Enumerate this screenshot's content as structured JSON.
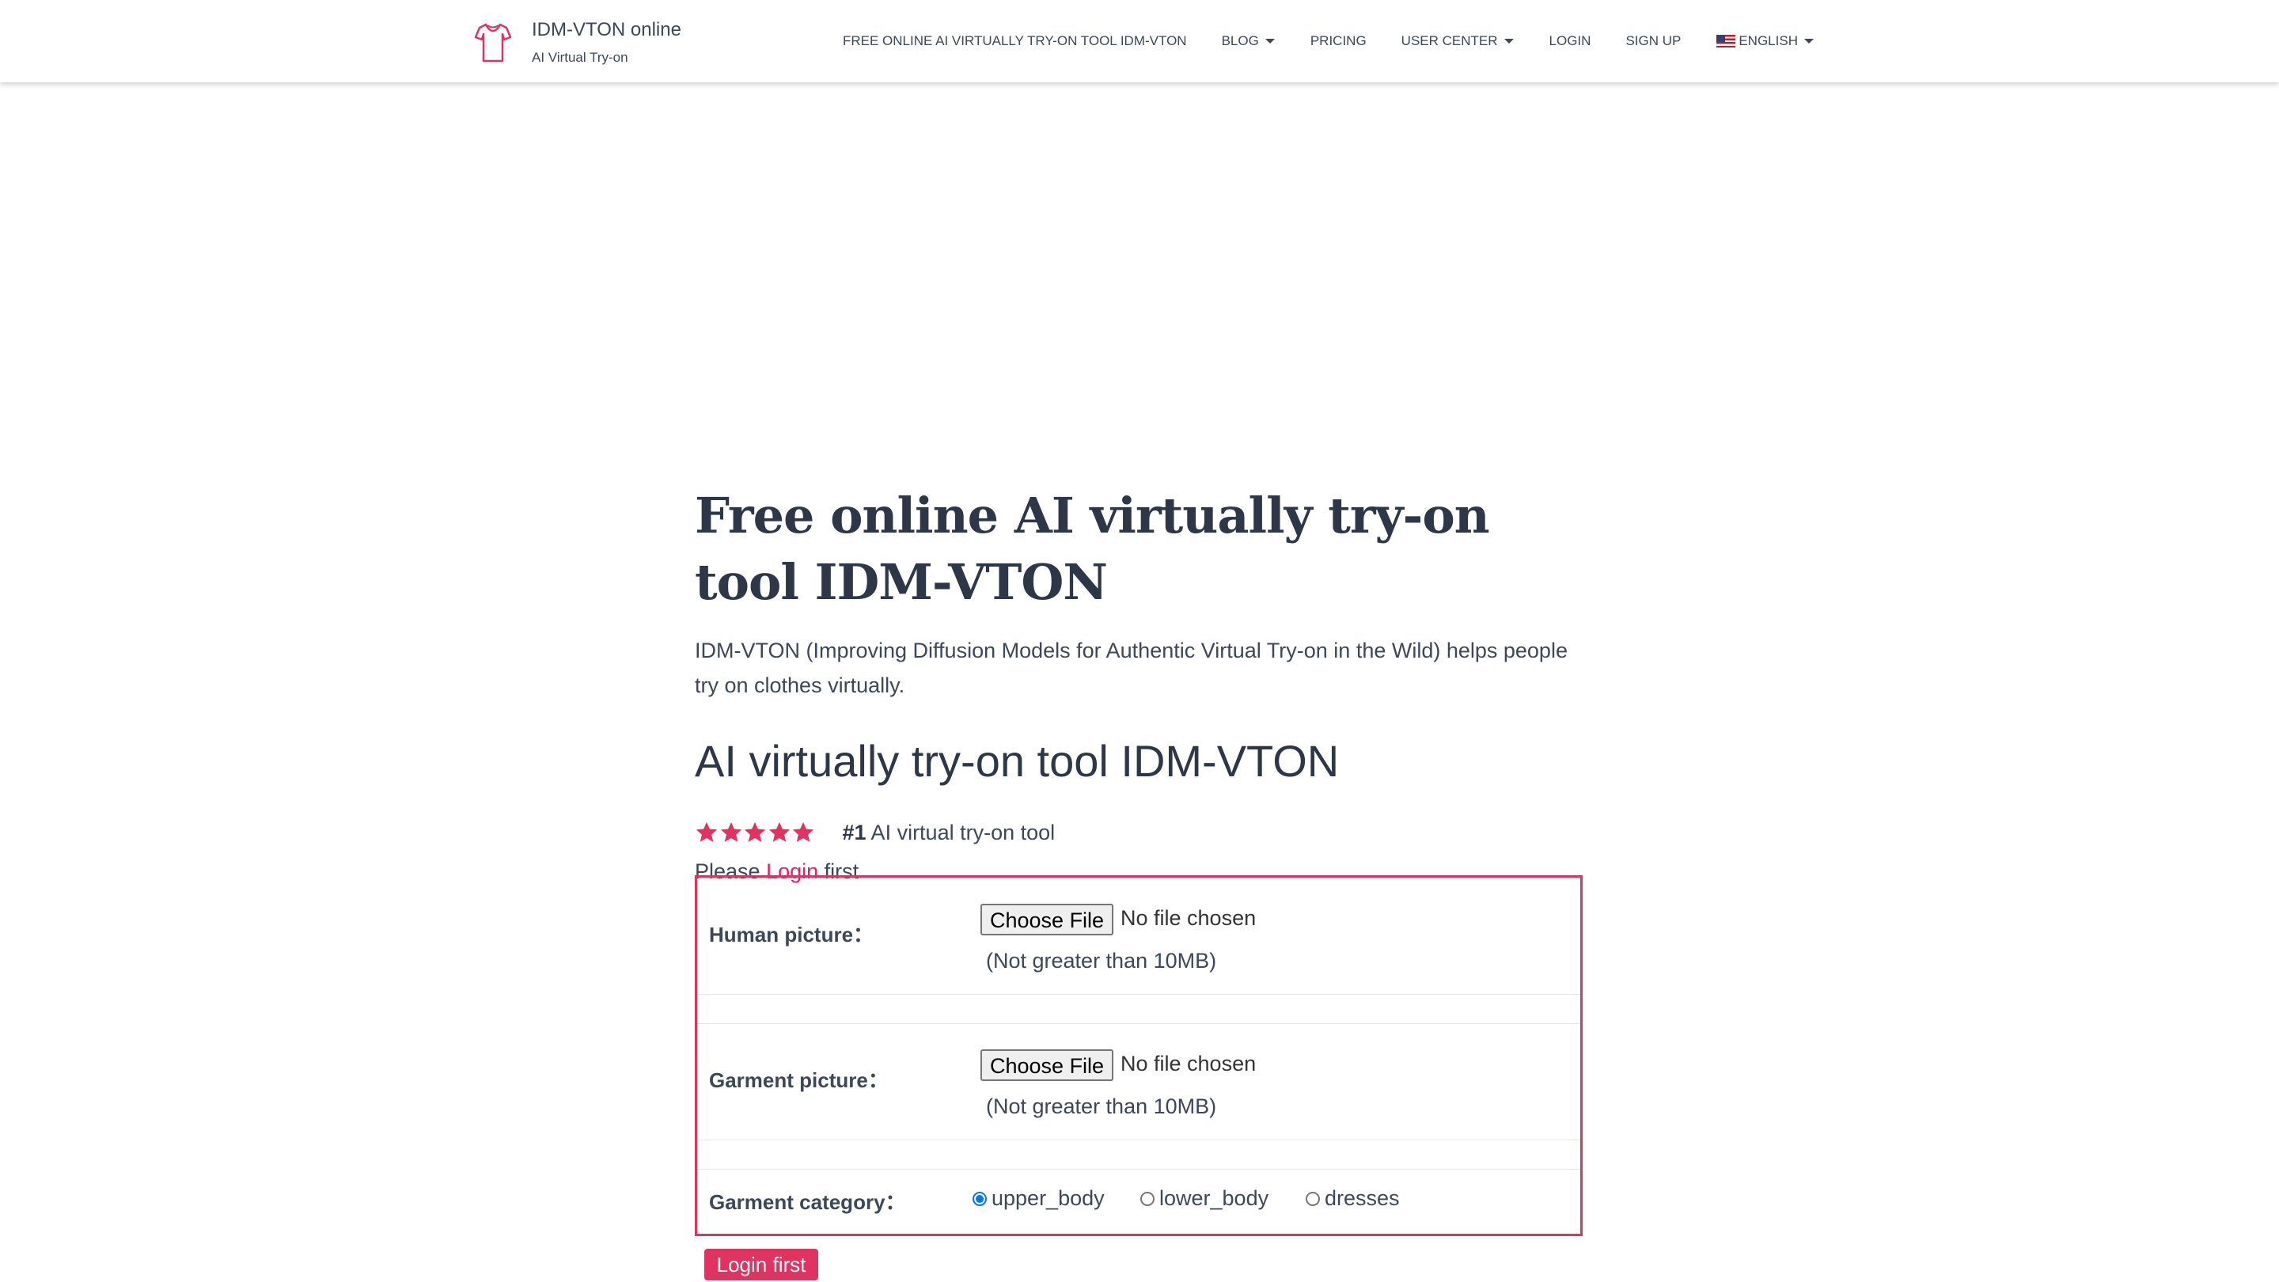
{
  "brand": {
    "title": "IDM-VTON online",
    "subtitle": "AI Virtual Try-on"
  },
  "nav": {
    "items": [
      {
        "label": "FREE ONLINE AI VIRTUALLY TRY-ON TOOL IDM-VTON",
        "dropdown": false
      },
      {
        "label": "BLOG",
        "dropdown": true
      },
      {
        "label": "PRICING",
        "dropdown": false
      },
      {
        "label": "USER CENTER",
        "dropdown": true
      },
      {
        "label": "LOGIN",
        "dropdown": false
      },
      {
        "label": "SIGN UP",
        "dropdown": false
      }
    ],
    "language": {
      "label": "ENGLISH",
      "icon": "us-flag-icon"
    }
  },
  "page": {
    "title": "Free online AI virtually try-on tool IDM-VTON",
    "description": "IDM-VTON (Improving Diffusion Models for Authentic Virtual Try-on in the Wild) helps people try on clothes virtually.",
    "section_title": "AI virtually try-on tool IDM-VTON",
    "rating": {
      "stars": 5,
      "rank": "#1",
      "rank_text": " AI virtual try-on tool"
    },
    "login_prompt": {
      "before": "Please ",
      "link": "Login",
      "after": " first"
    }
  },
  "form": {
    "human": {
      "label": "Human picture：",
      "button": "Choose File",
      "status": "No file chosen",
      "limit": "(Not greater than 10MB)"
    },
    "garment": {
      "label": "Garment picture：",
      "button": "Choose File",
      "status": "No file chosen",
      "limit": "(Not greater than 10MB)"
    },
    "category": {
      "label": "Garment category：",
      "options": [
        "upper_body",
        "lower_body",
        "dresses"
      ],
      "selected": "upper_body"
    },
    "submit": "Login first"
  },
  "colors": {
    "accent": "#e0335f",
    "text": "#3c4858",
    "heading": "#2d3748",
    "radio": "#0075ff"
  }
}
